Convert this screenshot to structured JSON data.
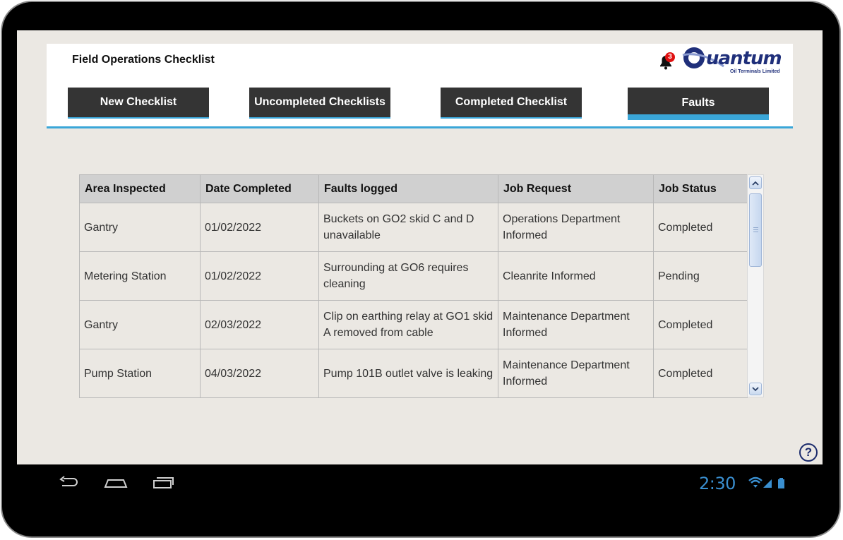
{
  "app": {
    "title": "Field Operations Checklist"
  },
  "tabs": [
    {
      "label": "New Checklist",
      "active": false
    },
    {
      "label": "Uncompleted Checklists",
      "active": false
    },
    {
      "label": "Completed Checklist",
      "active": false
    },
    {
      "label": "Faults",
      "active": true
    }
  ],
  "notifications": {
    "count": "3",
    "icon": "bell-icon"
  },
  "logo": {
    "word": "uantum",
    "subtitle": "Oil Terminals Limited"
  },
  "table": {
    "columns": [
      "Area Inspected",
      "Date Completed",
      "Faults logged",
      "Job Request",
      "Job Status"
    ],
    "rows": [
      [
        "Gantry",
        "01/02/2022",
        "Buckets on GO2 skid C and D unavailable",
        "Operations Department Informed",
        "Completed"
      ],
      [
        "Metering Station",
        "01/02/2022",
        "Surrounding at GO6 requires cleaning",
        "Cleanrite Informed",
        "Pending"
      ],
      [
        "Gantry",
        "02/03/2022",
        "Clip on earthing relay at GO1 skid A removed from cable",
        "Maintenance Department Informed",
        "Completed"
      ],
      [
        "Pump Station",
        "04/03/2022",
        "Pump 101B outlet valve is leaking",
        "Maintenance Department Informed",
        "Completed"
      ]
    ]
  },
  "help": {
    "label": "?"
  },
  "statusbar": {
    "time": "2:30"
  },
  "colors": {
    "accent": "#3aa6d8",
    "tab_bg": "#343434",
    "brand": "#1f2f7a",
    "clock": "#3a8fd0"
  }
}
